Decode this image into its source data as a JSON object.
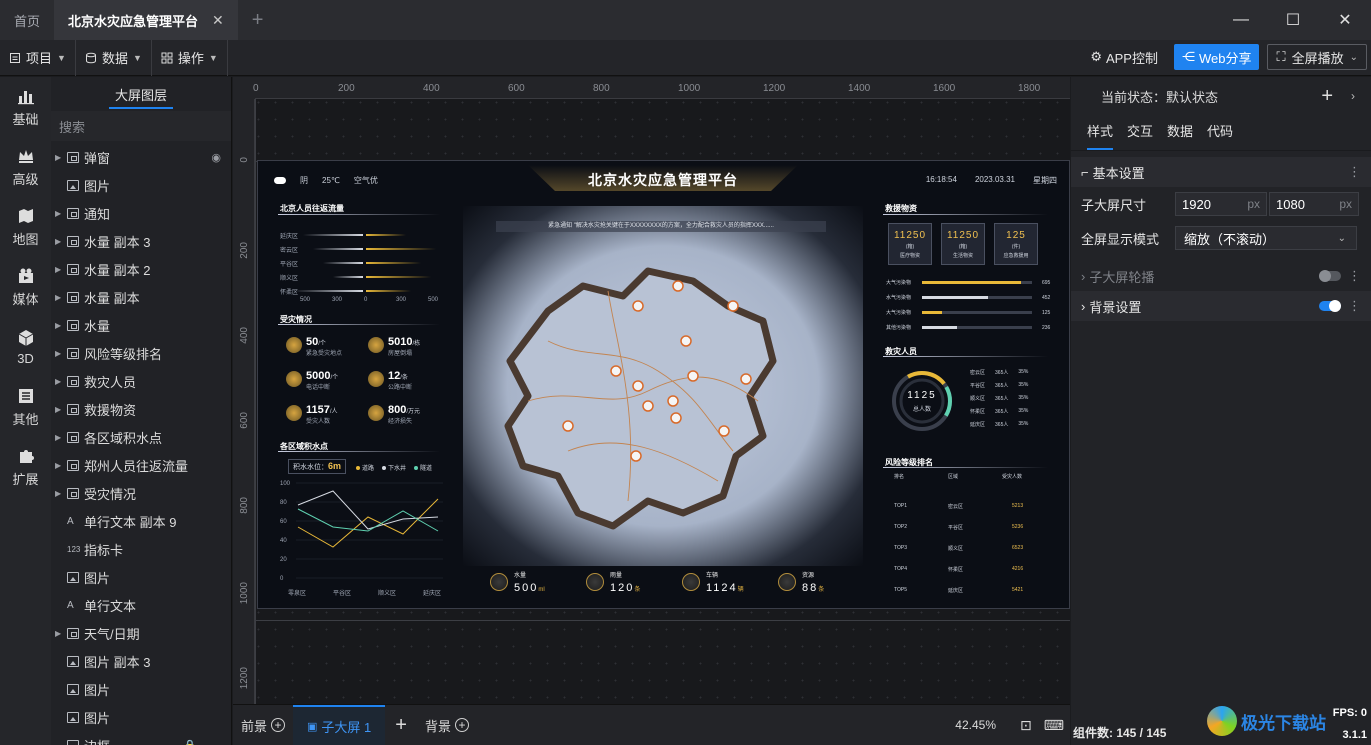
{
  "tabs": {
    "home": "首页",
    "active": "北京水灾应急管理平台",
    "close": "✕",
    "add": "+"
  },
  "window": {
    "minimize": "—",
    "maximize": "☐",
    "close": "✕"
  },
  "toolbar": {
    "menus": [
      {
        "label": "项目",
        "icon": "project-icon"
      },
      {
        "label": "数据",
        "icon": "database-icon"
      },
      {
        "label": "操作",
        "icon": "grid-icon"
      }
    ],
    "app_control": "APP控制",
    "web_share": "Web分享",
    "fullscreen": "全屏播放"
  },
  "rail": [
    {
      "label": "基础",
      "icon": "bar-chart-icon"
    },
    {
      "label": "高级",
      "icon": "crown-icon"
    },
    {
      "label": "地图",
      "icon": "map-icon"
    },
    {
      "label": "媒体",
      "icon": "media-icon"
    },
    {
      "label": "3D",
      "icon": "cube-icon"
    },
    {
      "label": "其他",
      "icon": "list-icon"
    },
    {
      "label": "扩展",
      "icon": "puzzle-icon"
    }
  ],
  "layers": {
    "title": "大屏图层",
    "search_placeholder": "搜索",
    "items": [
      {
        "label": "弹窗",
        "type": "grp",
        "caret": true,
        "hidden": true
      },
      {
        "label": "图片",
        "type": "img",
        "caret": false
      },
      {
        "label": "通知",
        "type": "grp",
        "caret": true
      },
      {
        "label": "水量 副本 3",
        "type": "grp",
        "caret": true
      },
      {
        "label": "水量 副本 2",
        "type": "grp",
        "caret": true
      },
      {
        "label": "水量 副本",
        "type": "grp",
        "caret": true
      },
      {
        "label": "水量",
        "type": "grp",
        "caret": true
      },
      {
        "label": "风险等级排名",
        "type": "grp",
        "caret": true
      },
      {
        "label": "救灾人员",
        "type": "grp",
        "caret": true
      },
      {
        "label": "救援物资",
        "type": "grp",
        "caret": true
      },
      {
        "label": "各区域积水点",
        "type": "grp",
        "caret": true
      },
      {
        "label": "郑州人员往返流量",
        "type": "grp",
        "caret": true
      },
      {
        "label": "受灾情况",
        "type": "grp",
        "caret": true
      },
      {
        "label": "单行文本 副本 9",
        "type": "txt",
        "caret": false
      },
      {
        "label": "指标卡",
        "type": "num",
        "caret": false
      },
      {
        "label": "图片",
        "type": "img",
        "caret": false
      },
      {
        "label": "单行文本",
        "type": "txt",
        "caret": false
      },
      {
        "label": "天气/日期",
        "type": "grp",
        "caret": true
      },
      {
        "label": "图片 副本 3",
        "type": "img",
        "caret": false
      },
      {
        "label": "图片",
        "type": "img",
        "caret": false
      },
      {
        "label": "图片",
        "type": "img",
        "caret": false
      },
      {
        "label": "边框",
        "type": "img",
        "caret": false,
        "locked": true
      }
    ]
  },
  "ruler": {
    "h": [
      "0",
      "200",
      "400",
      "600",
      "800",
      "1000",
      "1200",
      "1400",
      "1600",
      "1800"
    ],
    "v": [
      "0",
      "200",
      "400",
      "600",
      "800",
      "1000",
      "1200"
    ]
  },
  "screen": {
    "title": "北京水灾应急管理平台",
    "weather": {
      "cond": "阴",
      "temp": "25℃",
      "air": "空气优"
    },
    "time": {
      "clock": "16:18:54",
      "date": "2023.03.31",
      "weekday": "星期四"
    },
    "notice": "紧急通知 \"解决水灾抢关键在于XXXXXXXX的方案，全力配合救灾人员的指挥XXX......",
    "left": {
      "flow_title": "北京人员往返流量",
      "flow_rows": [
        "延庆区",
        "密云区",
        "平谷区",
        "顺义区",
        "怀柔区"
      ],
      "flow_axis": [
        "500",
        "300",
        "0",
        "300",
        "500"
      ],
      "disaster_title": "受灾情况",
      "kpis": [
        {
          "val": "50",
          "unit": "/个",
          "lbl": "紧急受灾地点"
        },
        {
          "val": "5010",
          "unit": "/栋",
          "lbl": "房屋倒塌"
        },
        {
          "val": "5000",
          "unit": "/个",
          "lbl": "电话中断"
        },
        {
          "val": "12",
          "unit": "/条",
          "lbl": "公路中断"
        },
        {
          "val": "1157",
          "unit": "/人",
          "lbl": "受灾人数"
        },
        {
          "val": "800",
          "unit": "/万元",
          "lbl": "经济损失"
        }
      ],
      "water_title": "各区域积水点",
      "water_level_label": "积水水位：",
      "water_level": "6m",
      "legend": [
        "道路",
        "下水井",
        "隧道"
      ],
      "y_ticks": [
        "100",
        "80",
        "60",
        "40",
        "20",
        "0"
      ],
      "x_ticks": [
        "零泉区",
        "平谷区",
        "顺义区",
        "延庆区"
      ]
    },
    "right": {
      "material_title": "救援物资",
      "materials": [
        {
          "n": "11250",
          "u": "(箱)",
          "l": "医疗物资"
        },
        {
          "n": "11250",
          "u": "(箱)",
          "l": "生活物资"
        },
        {
          "n": "125",
          "u": "(件)",
          "l": "应急救援用"
        }
      ],
      "bars": [
        {
          "lbl": "大气污染物",
          "val": "695",
          "pct": 0.9,
          "color": "#e8b838"
        },
        {
          "lbl": "水气污染物",
          "val": "452",
          "pct": 0.6,
          "color": "#d6dae2"
        },
        {
          "lbl": "大气污染物",
          "val": "125",
          "pct": 0.18,
          "color": "#e8b838"
        },
        {
          "lbl": "其他污染物",
          "val": "236",
          "pct": 0.32,
          "color": "#d6dae2"
        }
      ],
      "rescue_title": "救灾人员",
      "rescue_total": "1125",
      "rescue_total_label": "总人数",
      "rescue_rows": [
        {
          "area": "密云区",
          "count": "365人",
          "pct": "35%"
        },
        {
          "area": "平谷区",
          "count": "365人",
          "pct": "35%"
        },
        {
          "area": "顺义区",
          "count": "365人",
          "pct": "35%"
        },
        {
          "area": "怀柔区",
          "count": "365人",
          "pct": "35%"
        },
        {
          "area": "延庆区",
          "count": "365人",
          "pct": "35%"
        }
      ],
      "risk_title": "风险等级排名",
      "risk_head": [
        "排名",
        "区域",
        "受灾人数"
      ],
      "risk_rows": [
        {
          "rank": "TOP1",
          "area": "密云区",
          "num": "5213"
        },
        {
          "rank": "TOP2",
          "area": "平谷区",
          "num": "5236"
        },
        {
          "rank": "TOP3",
          "area": "顺义区",
          "num": "6523"
        },
        {
          "rank": "TOP4",
          "area": "怀柔区",
          "num": "4216"
        },
        {
          "rank": "TOP5",
          "area": "延庆区",
          "num": "5421"
        }
      ]
    },
    "bottom": [
      {
        "lbl": "水量",
        "num": "500",
        "unit": "ml"
      },
      {
        "lbl": "雨量",
        "num": "120",
        "unit": "条"
      },
      {
        "lbl": "车辆",
        "num": "1124",
        "unit": "辆"
      },
      {
        "lbl": "资源",
        "num": "88",
        "unit": "条"
      }
    ]
  },
  "bottombar": {
    "front": "前景",
    "child": "子大屏 1",
    "back": "背景",
    "zoom": "42.45%"
  },
  "props": {
    "state_label": "当前状态：",
    "state_value": "默认状态",
    "tabs": [
      "样式",
      "交互",
      "数据",
      "代码"
    ],
    "basic_section": "基本设置",
    "size_label": "子大屏尺寸",
    "width": "1920",
    "height": "1080",
    "px": "px",
    "mode_label": "全屏显示模式",
    "mode_value": "缩放（不滚动）",
    "carousel_section": "子大屏轮播",
    "bg_section": "背景设置",
    "count_label": "组件数: 145 / 145",
    "fps": "FPS: 0",
    "version": "3.1.1",
    "watermark": "极光下载站"
  }
}
